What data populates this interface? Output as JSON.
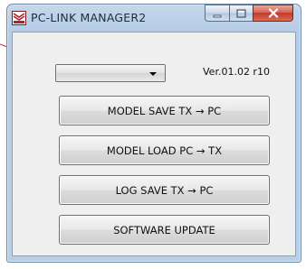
{
  "window": {
    "title": "PC-LINK MANAGER2",
    "version": "Ver.01.02 r10"
  },
  "buttons": {
    "model_save": "MODEL SAVE TX → PC",
    "model_load": "MODEL LOAD PC → TX",
    "log_save": "LOG SAVE TX → PC",
    "software_update": "SOFTWARE UPDATE"
  },
  "dropdown": {
    "selected": ""
  },
  "icons": {
    "app": "app-logo-icon",
    "minimize": "minimize-icon",
    "maximize": "maximize-icon",
    "close": "close-icon",
    "dropdown_arrow": "chevron-down-icon"
  },
  "colors": {
    "callout_line": "#d0243a",
    "close_button": "#c1392c",
    "title_bar": "#b7cde6"
  }
}
